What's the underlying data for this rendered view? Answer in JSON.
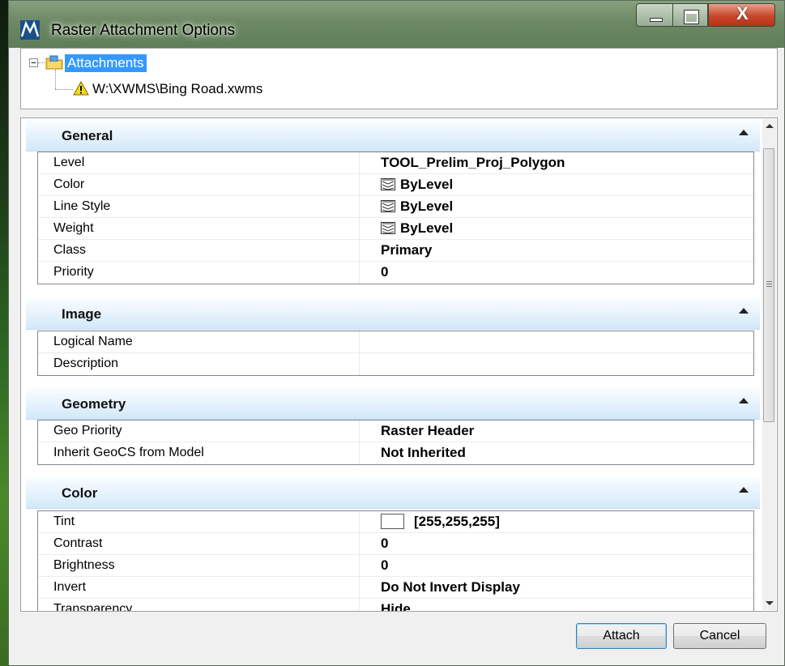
{
  "window": {
    "title": "Raster Attachment Options",
    "controls": {
      "minimize": "minimize",
      "maximize": "maximize",
      "close": "X"
    }
  },
  "tree": {
    "expander": "−",
    "root_label": "Attachments",
    "child_label": "W:\\XWMS\\Bing Road.xwms"
  },
  "sections": {
    "general": {
      "title": "General",
      "rows": [
        {
          "label": "Level",
          "value": "TOOL_Prelim_Proj_Polygon"
        },
        {
          "label": "Color",
          "value": "ByLevel"
        },
        {
          "label": "Line Style",
          "value": "ByLevel"
        },
        {
          "label": "Weight",
          "value": "ByLevel"
        },
        {
          "label": "Class",
          "value": "Primary"
        },
        {
          "label": "Priority",
          "value": "0"
        }
      ]
    },
    "image": {
      "title": "Image",
      "rows": [
        {
          "label": "Logical Name",
          "value": ""
        },
        {
          "label": "Description",
          "value": ""
        }
      ]
    },
    "geometry": {
      "title": "Geometry",
      "rows": [
        {
          "label": "Geo Priority",
          "value": "Raster Header"
        },
        {
          "label": "Inherit GeoCS from Model",
          "value": "Not Inherited"
        }
      ]
    },
    "color": {
      "title": "Color",
      "rows": [
        {
          "label": "Tint",
          "value": "[255,255,255]"
        },
        {
          "label": "Contrast",
          "value": "0"
        },
        {
          "label": "Brightness",
          "value": "0"
        },
        {
          "label": "Invert",
          "value": "Do Not Invert Display"
        },
        {
          "label": "Transparency",
          "value": "Hide"
        }
      ]
    }
  },
  "buttons": {
    "attach": "Attach",
    "cancel": "Cancel"
  },
  "colors": {
    "selection": "#3399ff",
    "section_header": "#d3e8f9",
    "tint": "#ffffff"
  }
}
